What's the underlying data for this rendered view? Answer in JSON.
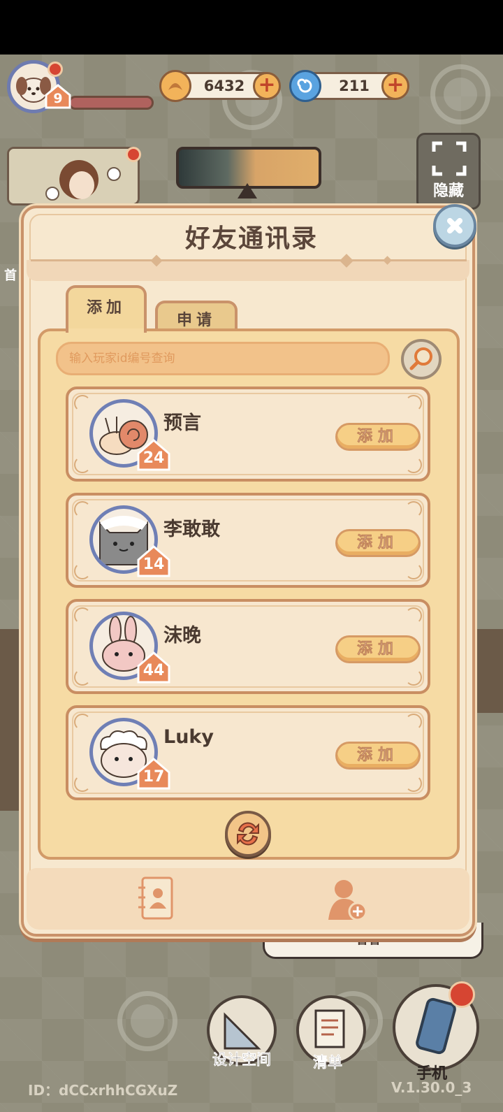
{
  "hud": {
    "player_level": "9",
    "coins": "6432",
    "gems": "211",
    "hide_label": "隐藏",
    "partial_side_label": "首"
  },
  "dialog": {
    "title": "好友通讯录",
    "tabs": [
      {
        "label": "添加",
        "active": true
      },
      {
        "label": "申请",
        "active": false
      }
    ],
    "search": {
      "placeholder": "输入玩家id编号查询",
      "value": ""
    },
    "friends": [
      {
        "name": "预言",
        "level": "24",
        "avatar": "snail-avatar",
        "add_label": "添加"
      },
      {
        "name": "李敢敢",
        "level": "14",
        "avatar": "gray-cat-avatar",
        "add_label": "添加"
      },
      {
        "name": "沫晚",
        "level": "44",
        "avatar": "bunny-avatar",
        "add_label": "添加"
      },
      {
        "name": "Luky",
        "level": "17",
        "avatar": "sheep-avatar",
        "add_label": "添加"
      }
    ],
    "footer": {
      "left_icon": "contacts-book-icon",
      "right_icon": "add-friend-icon"
    }
  },
  "bottom_bar": {
    "design_label": "设计空间",
    "list_label": "清单",
    "phone_label": "手机",
    "speech_text": "看看~"
  },
  "footer_info": {
    "id_text": "ID：dCCxrhhCGXuZ",
    "version": "V.1.30.0_3"
  },
  "colors": {
    "panel": "#f7e8cf",
    "panel_border": "#c9926a",
    "button": "#f6cf86",
    "avatar_ring": "#6f7fb5",
    "level_badge": "#e8895a"
  }
}
